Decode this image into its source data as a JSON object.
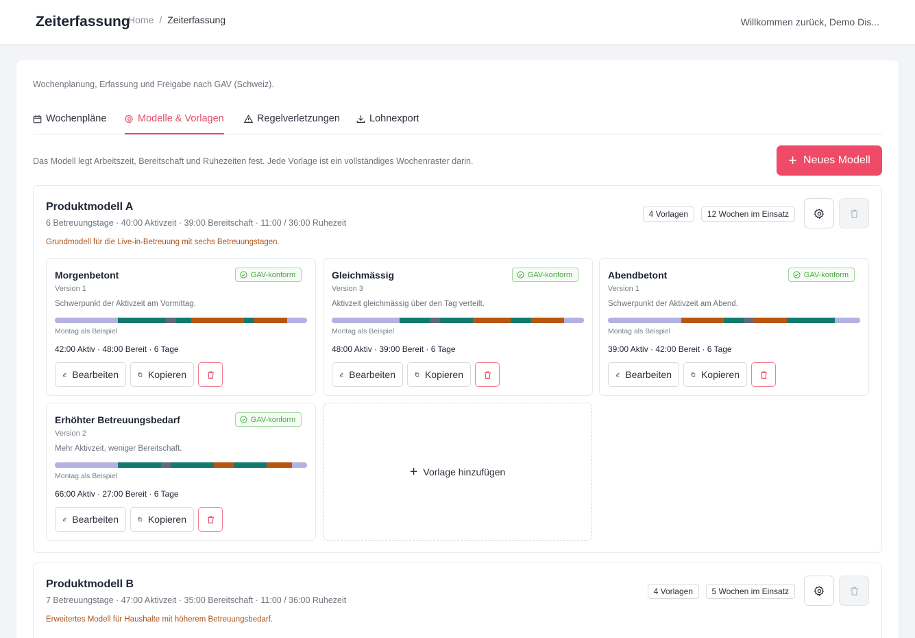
{
  "header": {
    "app_title": "Zeiterfassung",
    "breadcrumb": [
      "Home",
      "Zeiterfassung"
    ],
    "breadcrumb_separator": "/",
    "welcome": "Willkommen zurück, Demo Dis..."
  },
  "page": {
    "subtitle": "Wochenplanung, Erfassung und Freigabe nach GAV (Schweiz).",
    "tabs": [
      {
        "label": "Wochenpläne",
        "icon": "calendar-icon",
        "active": false
      },
      {
        "label": "Modelle & Vorlagen",
        "icon": "gear-icon",
        "active": true
      },
      {
        "label": "Regelverletzungen",
        "icon": "warning-triangle-icon",
        "active": false
      },
      {
        "label": "Lohnexport",
        "icon": "download-icon",
        "active": false
      }
    ],
    "intro": "Das Modell legt Arbeitszeit, Bereitschaft und Ruhezeiten fest. Jede Vorlage ist ein vollständiges Wochenraster darin.",
    "new_model_button": "Neues Modell"
  },
  "colors": {
    "accent": "#ef4a67",
    "bereit": "#b3b2e3",
    "aktiv": "#137b6e",
    "spezial": "#b8560f",
    "pause": "#626a7a",
    "gav_green": "#4aa844"
  },
  "models": [
    {
      "name": "Produktmodell A",
      "meta": "6 Betreuungstage · 40:00 Aktivzeit · 39:00 Bereitschaft · 11:00 / 36:00 Ruhezeit",
      "description": "Grundmodell für die Live-in-Betreuung mit sechs Betreuungstagen.",
      "vorlagen_badge": "4 Vorlagen",
      "einsatz_badge": "12 Wochen im Einsatz",
      "templates": [
        {
          "name": "Morgenbetont",
          "version": "Version 1",
          "gav": "GAV-konform",
          "description": "Schwerpunkt der Aktivzeit am Vormittag.",
          "note": "Montag als Beispiel",
          "stats": "42:00 Aktiv · 48:00 Bereit · 6 Tage",
          "edit": "Bearbeiten",
          "copy": "Kopieren",
          "segments": [
            [
              "bereit",
              0.25
            ],
            [
              "aktiv",
              0.19
            ],
            [
              "pause",
              0.04
            ],
            [
              "aktiv",
              0.06
            ],
            [
              "spezial",
              0.21
            ],
            [
              "aktiv",
              0.04
            ],
            [
              "spezial",
              0.13
            ],
            [
              "bereit",
              0.08
            ]
          ]
        },
        {
          "name": "Gleichmässig",
          "version": "Version 3",
          "gav": "GAV-konform",
          "description": "Aktivzeit gleichmässig über den Tag verteilt.",
          "note": "Montag als Beispiel",
          "stats": "48:00 Aktiv · 39:00 Bereit · 6 Tage",
          "edit": "Bearbeiten",
          "copy": "Kopieren",
          "segments": [
            [
              "bereit",
              0.27
            ],
            [
              "aktiv",
              0.12
            ],
            [
              "pause",
              0.04
            ],
            [
              "aktiv",
              0.13
            ],
            [
              "spezial",
              0.15
            ],
            [
              "aktiv",
              0.08
            ],
            [
              "spezial",
              0.13
            ],
            [
              "bereit",
              0.08
            ]
          ]
        },
        {
          "name": "Abendbetont",
          "version": "Version 1",
          "gav": "GAV-konform",
          "description": "Schwerpunkt der Aktivzeit am Abend.",
          "note": "Montag als Beispiel",
          "stats": "39:00 Aktiv · 42:00 Bereit · 6 Tage",
          "edit": "Bearbeiten",
          "copy": "Kopieren",
          "segments": [
            [
              "bereit",
              0.29
            ],
            [
              "spezial",
              0.17
            ],
            [
              "aktiv",
              0.08
            ],
            [
              "pause",
              0.04
            ],
            [
              "spezial",
              0.13
            ],
            [
              "aktiv",
              0.19
            ],
            [
              "bereit",
              0.1
            ]
          ]
        },
        {
          "name": "Erhöhter Betreuungsbedarf",
          "version": "Version 2",
          "gav": "GAV-konform",
          "description": "Mehr Aktivzeit, weniger Bereitschaft.",
          "note": "Montag als Beispiel",
          "stats": "66:00 Aktiv · 27:00 Bereit · 6 Tage",
          "edit": "Bearbeiten",
          "copy": "Kopieren",
          "segments": [
            [
              "bereit",
              0.25
            ],
            [
              "aktiv",
              0.17
            ],
            [
              "pause",
              0.04
            ],
            [
              "aktiv",
              0.17
            ],
            [
              "spezial",
              0.08
            ],
            [
              "aktiv",
              0.13
            ],
            [
              "spezial",
              0.1
            ],
            [
              "bereit",
              0.06
            ]
          ]
        }
      ],
      "add_template": "Vorlage hinzufügen"
    },
    {
      "name": "Produktmodell B",
      "meta": "7 Betreuungstage · 47:00 Aktivzeit · 35:00 Bereitschaft · 11:00 / 36:00 Ruhezeit",
      "description": "Erweitertes Modell für Haushalte mit höherem Betreuungsbedarf.",
      "vorlagen_badge": "4 Vorlagen",
      "einsatz_badge": "5 Wochen im Einsatz"
    }
  ]
}
